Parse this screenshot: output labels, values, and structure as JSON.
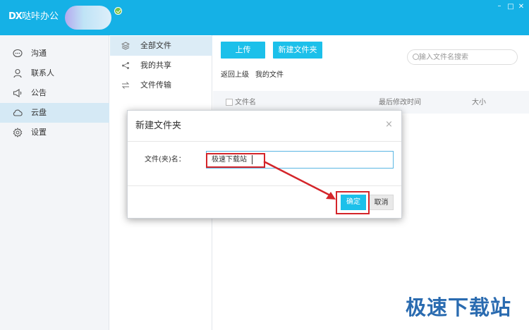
{
  "app": {
    "title": "哒咔办公",
    "logo": "DX",
    "verify_tag": ""
  },
  "window_controls": {
    "minimize": "–",
    "maximize": "□",
    "close": "✕"
  },
  "sidebar": {
    "items": [
      {
        "label": "沟通",
        "icon": "chat-icon"
      },
      {
        "label": "联系人",
        "icon": "person-icon"
      },
      {
        "label": "公告",
        "icon": "announce-icon"
      },
      {
        "label": "云盘",
        "icon": "cloud-icon",
        "active": true
      },
      {
        "label": "设置",
        "icon": "gear-icon"
      }
    ]
  },
  "folders": {
    "items": [
      {
        "label": "全部文件",
        "icon": "layers-icon",
        "active": true
      },
      {
        "label": "我的共享",
        "icon": "share-icon"
      },
      {
        "label": "文件传输",
        "icon": "transfer-icon"
      }
    ]
  },
  "toolbar": {
    "upload_label": "上传",
    "new_folder_label": "新建文件夹"
  },
  "search": {
    "placeholder": "输入文件名搜索"
  },
  "breadcrumb": {
    "back": "返回上级",
    "current": "我的文件"
  },
  "table": {
    "headers": {
      "name": "文件名",
      "modified": "最后修改时间",
      "size": "大小"
    }
  },
  "dialog": {
    "title": "新建文件夹",
    "close": "×",
    "field_label": "文件(夹)名：",
    "field_value": "极速下载站",
    "confirm_label": "确定",
    "cancel_label": "取消"
  },
  "watermark": {
    "text": "极速下载站"
  },
  "colors": {
    "accent": "#1cc0ea",
    "titlebar": "#15b1e6",
    "highlight": "#d4252a",
    "watermark": "#2a6bb0"
  }
}
